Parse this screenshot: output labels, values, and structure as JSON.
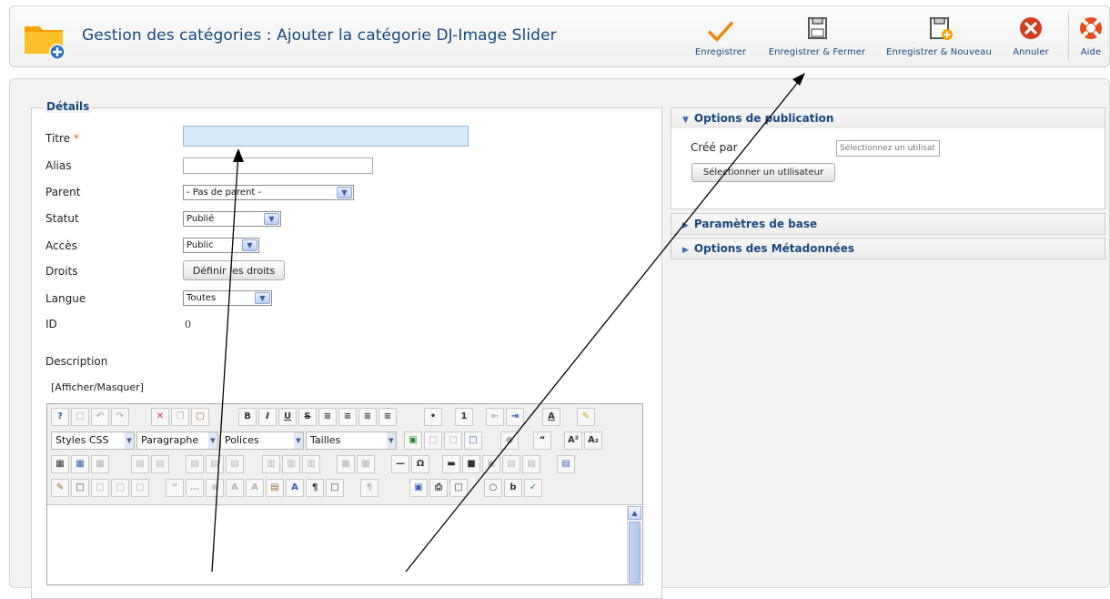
{
  "header": {
    "title": "Gestion des catégories : Ajouter la catégorie DJ-Image Slider",
    "icon": "folder-add-icon"
  },
  "toolbar": {
    "save": "Enregistrer",
    "save_close": "Enregistrer & Fermer",
    "save_new": "Enregistrer & Nouveau",
    "cancel": "Annuler",
    "help": "Aide"
  },
  "details": {
    "legend": "Détails",
    "title_label": "Titre",
    "required_mark": "*",
    "title_value": "",
    "alias_label": "Alias",
    "alias_value": "",
    "parent_label": "Parent",
    "parent_value": "- Pas de parent -",
    "status_label": "Statut",
    "status_value": "Publié",
    "access_label": "Accès",
    "access_value": "Public",
    "rights_label": "Droits",
    "rights_button": "Définir les droits",
    "language_label": "Langue",
    "language_value": "Toutes",
    "id_label": "ID",
    "id_value": "0",
    "description_label": "Description",
    "toggle_editor": "[Afficher/Masquer]"
  },
  "editor": {
    "styles": "Styles CSS",
    "format": "Paragraphe",
    "fonts": "Polices",
    "sizes": "Tailles"
  },
  "publishing": {
    "heading": "Options de publication",
    "created_by_label": "Créé par",
    "user_placeholder": "Sélectionnez un utilisat",
    "select_user_button": "Sélectionner un utilisateur"
  },
  "basic": {
    "heading": "Paramètres de base"
  },
  "metadata": {
    "heading": "Options des Métadonnées"
  },
  "colors": {
    "title_blue": "#15487f",
    "save_orange": "#e8870c",
    "cancel_red": "#d33c1d",
    "highlight_input": "#d6eafb"
  }
}
